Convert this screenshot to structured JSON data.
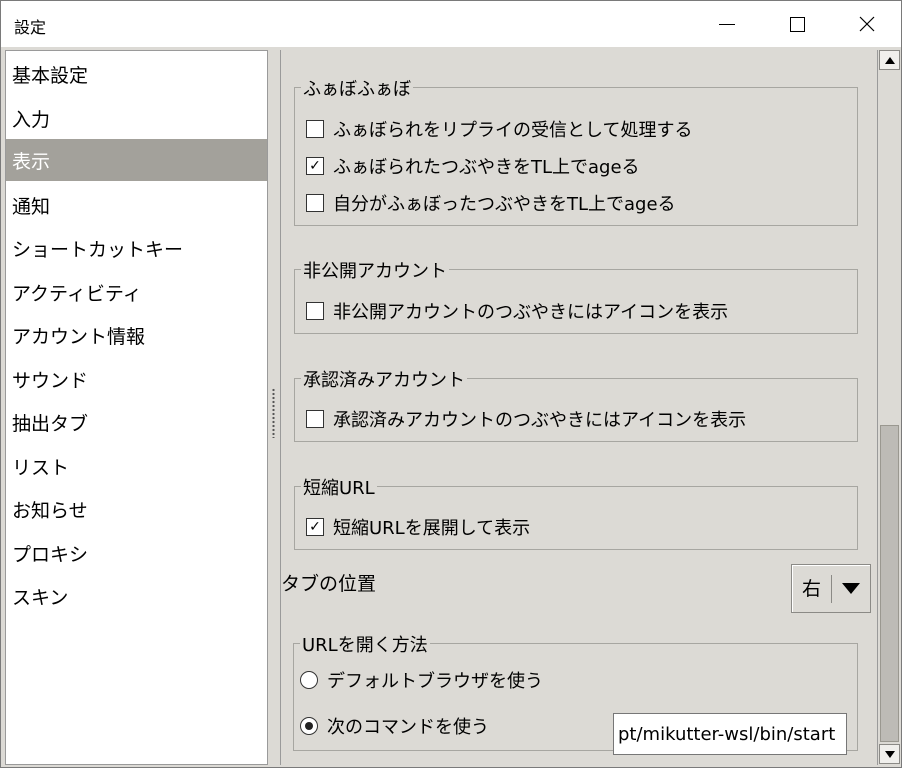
{
  "window": {
    "title": "設定"
  },
  "sidebar": {
    "items": [
      {
        "label": "基本設定"
      },
      {
        "label": "入力"
      },
      {
        "label": "表示",
        "selected": true
      },
      {
        "label": "通知"
      },
      {
        "label": "ショートカットキー"
      },
      {
        "label": "アクティビティ"
      },
      {
        "label": "アカウント情報"
      },
      {
        "label": "サウンド"
      },
      {
        "label": "抽出タブ"
      },
      {
        "label": "リスト"
      },
      {
        "label": "お知らせ"
      },
      {
        "label": "プロキシ"
      },
      {
        "label": "スキン"
      }
    ]
  },
  "groups": {
    "fav": {
      "title": "ふぁぼふぁぼ",
      "options": [
        {
          "label": "ふぁぼられをリプライの受信として処理する",
          "checked": false
        },
        {
          "label": "ふぁぼられたつぶやきをTL上でageる",
          "checked": true
        },
        {
          "label": "自分がふぁぼったつぶやきをTL上でageる",
          "checked": false
        }
      ]
    },
    "private": {
      "title": "非公開アカウント",
      "options": [
        {
          "label": "非公開アカウントのつぶやきにはアイコンを表示",
          "checked": false
        }
      ]
    },
    "verified": {
      "title": "承認済みアカウント",
      "options": [
        {
          "label": "承認済みアカウントのつぶやきにはアイコンを表示",
          "checked": false
        }
      ]
    },
    "shorturl": {
      "title": "短縮URL",
      "options": [
        {
          "label": "短縮URLを展開して表示",
          "checked": true
        }
      ]
    },
    "openurl": {
      "title": "URLを開く方法",
      "options": [
        {
          "label": "デフォルトブラウザを使う",
          "selected": false
        },
        {
          "label": "次のコマンドを使う",
          "selected": true
        }
      ],
      "command_value": "pt/mikutter-wsl/bin/start"
    }
  },
  "tab_position": {
    "label": "タブの位置",
    "value": "右"
  },
  "icons": {
    "check": "✓",
    "minimize": "minimize-icon",
    "maximize": "maximize-icon",
    "close": "close-icon"
  }
}
